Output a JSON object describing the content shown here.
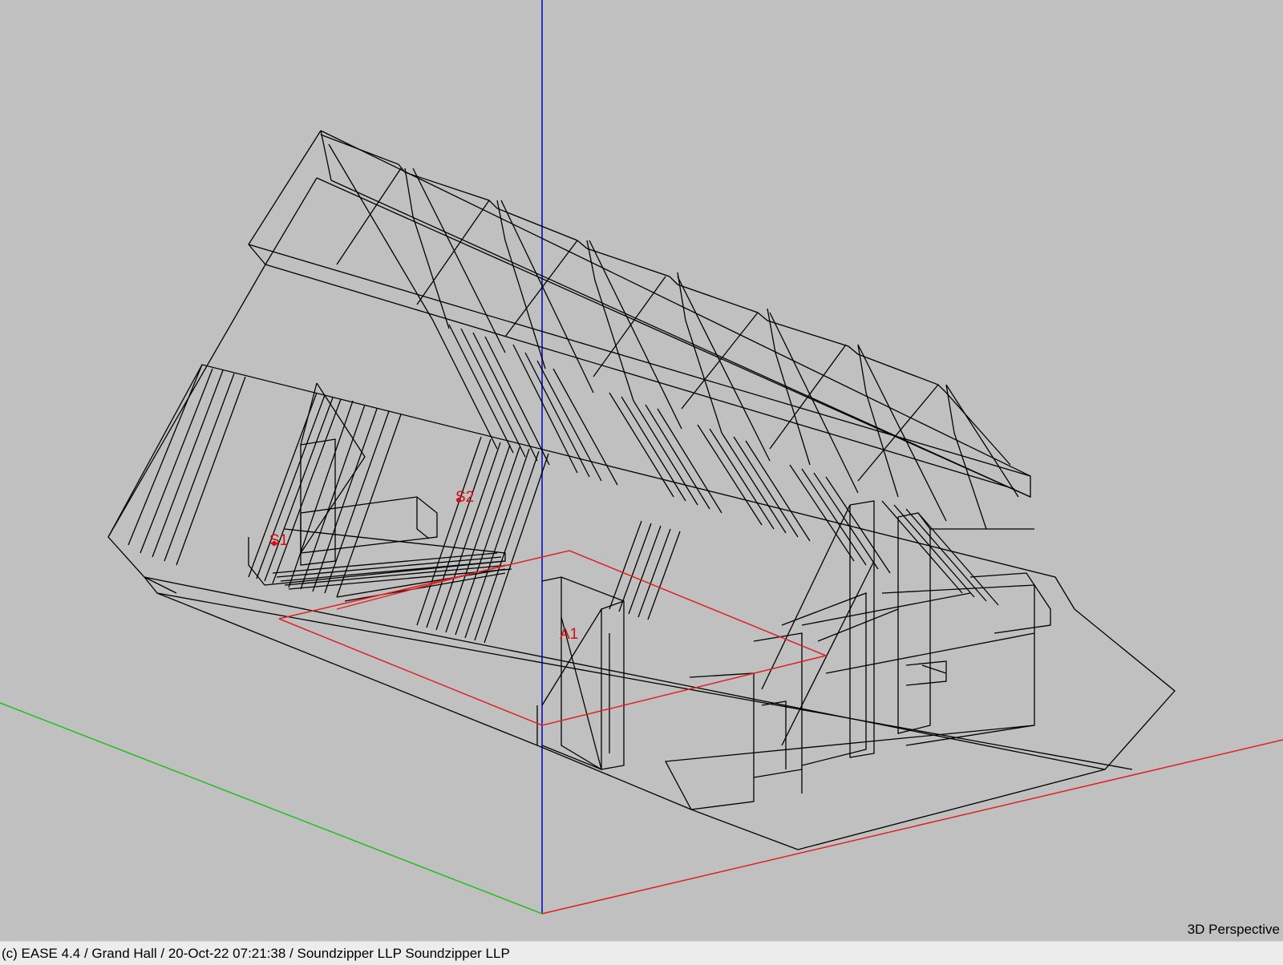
{
  "viewport": {
    "view_mode": "3D Perspective",
    "labels": {
      "s1": "S1",
      "s2": "S2",
      "a1": "A1"
    },
    "colors": {
      "background": "#c0c0c0",
      "wireframe": "#000000",
      "audience_area": "#e02020",
      "x_axis": "#e02020",
      "y_axis": "#20c020",
      "z_axis": "#3030c0"
    }
  },
  "status_bar": {
    "text": "(c) EASE 4.4  / Grand Hall  / 20-Oct-22 07:21:38 / Soundzipper LLP Soundzipper LLP"
  }
}
